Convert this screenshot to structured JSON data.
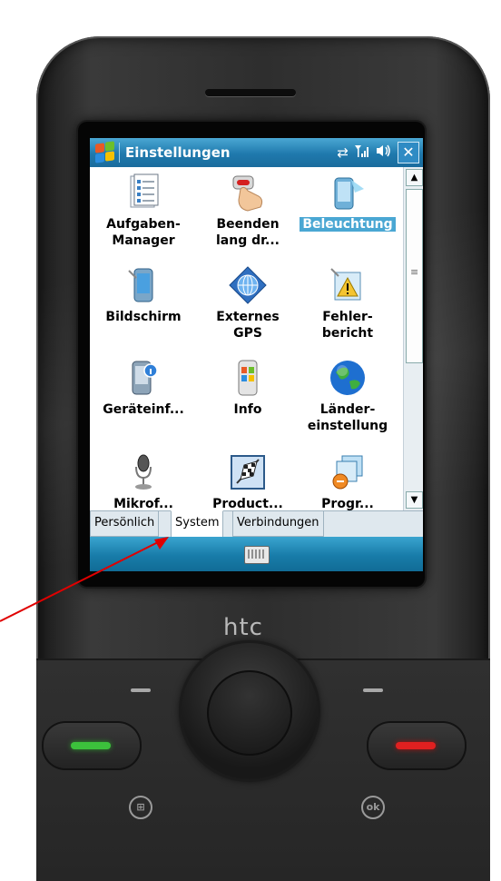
{
  "titlebar": {
    "title": "Einstellungen",
    "icons": [
      "start-icon",
      "data-sync-icon",
      "signal-icon",
      "volume-icon"
    ],
    "close_label": "✕"
  },
  "items": [
    {
      "label_line1": "Aufgaben-",
      "label_line2": "Manager",
      "icon": "task-manager-icon",
      "selected": false
    },
    {
      "label_line1": "Beenden",
      "label_line2": "lang dr...",
      "icon": "hand-press-icon",
      "selected": false
    },
    {
      "label_line1": "Beleuchtung",
      "label_line2": "",
      "icon": "backlight-icon",
      "selected": true
    },
    {
      "label_line1": "Bildschirm",
      "label_line2": "",
      "icon": "screen-icon",
      "selected": false
    },
    {
      "label_line1": "Externes",
      "label_line2": "GPS",
      "icon": "gps-globe-icon",
      "selected": false
    },
    {
      "label_line1": "Fehler-",
      "label_line2": "bericht",
      "icon": "error-report-icon",
      "selected": false
    },
    {
      "label_line1": "Geräteinf...",
      "label_line2": "",
      "icon": "device-info-icon",
      "selected": false
    },
    {
      "label_line1": "Info",
      "label_line2": "",
      "icon": "windows-info-icon",
      "selected": false
    },
    {
      "label_line1": "Länder-",
      "label_line2": "einstellung",
      "icon": "earth-globe-icon",
      "selected": false
    },
    {
      "label_line1": "Mikrof...",
      "label_line2": "",
      "icon": "microphone-icon",
      "selected": false
    },
    {
      "label_line1": "Product...",
      "label_line2": "",
      "icon": "checkered-flag-icon",
      "selected": false
    },
    {
      "label_line1": "Progr...",
      "label_line2": "",
      "icon": "programs-icon",
      "selected": false
    }
  ],
  "tabs": [
    {
      "label": "Persönlich",
      "active": false
    },
    {
      "label": "System",
      "active": true
    },
    {
      "label": "Verbindungen",
      "active": false
    }
  ],
  "softbar": {
    "icon": "keyboard-icon"
  },
  "device": {
    "brand": "htc",
    "ok_label": "ok",
    "win_label": "⊞"
  },
  "colors": {
    "titlebar": "#1f79ad",
    "selection": "#4aa7d3",
    "annotation_arrow": "#e00000",
    "call": "#3cc13c",
    "end": "#e02020"
  }
}
